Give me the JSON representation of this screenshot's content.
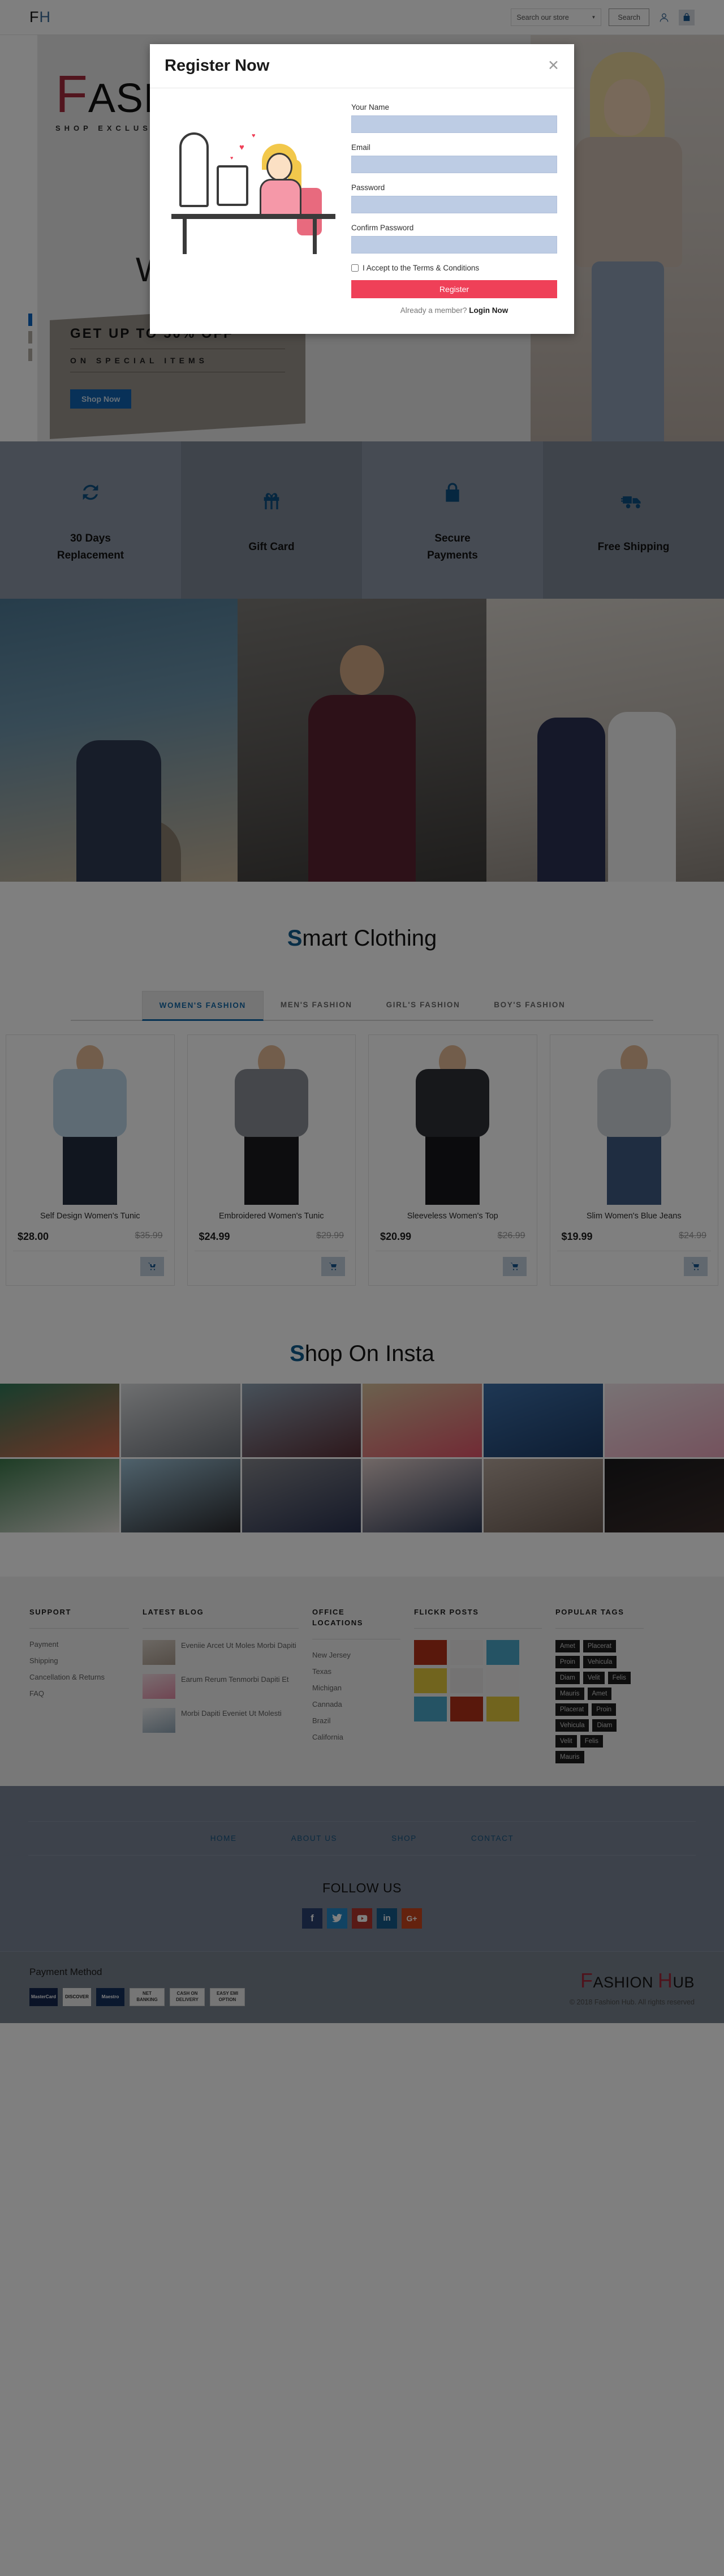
{
  "header": {
    "logo_first": "F",
    "logo_second": "H",
    "search_placeholder": "Search our store",
    "search_caret": "▼",
    "search_button": "Search",
    "account_icon": "user-icon",
    "cart_icon": "shopping-bag-icon"
  },
  "hero": {
    "brand_cap": "F",
    "brand_rest": "ASHION HUB",
    "tagline": "SHOP EXCLUSIVE",
    "welcome": "Welcome",
    "offer_line1": "GET UP TO 50% OFF",
    "offer_line2": "ON     SPECIAL     ITEMS",
    "shop_now": "Shop Now"
  },
  "features": [
    {
      "icon": "refresh-icon",
      "label": "30 Days\nReplacement"
    },
    {
      "icon": "gift-icon",
      "label": "Gift Card"
    },
    {
      "icon": "lock-icon",
      "label": "Secure\nPayments"
    },
    {
      "icon": "truck-icon",
      "label": "Free Shipping"
    }
  ],
  "smart_clothing": {
    "title_cap": "S",
    "title_rest": "mart Clothing",
    "tabs": [
      {
        "label": "WOMEN'S FASHION",
        "active": true
      },
      {
        "label": "MEN'S FASHION",
        "active": false
      },
      {
        "label": "GIRL'S FASHION",
        "active": false
      },
      {
        "label": "BOY'S FASHION",
        "active": false
      }
    ],
    "products": [
      {
        "name": "Self Design Women's Tunic",
        "price": "$28.00",
        "old_price": "$35.99",
        "cart_icon": "add-to-cart-icon",
        "shirt_color": "#bcd6e8"
      },
      {
        "name": "Embroidered Women's Tunic",
        "price": "$24.99",
        "old_price": "$29.99",
        "cart_icon": "add-to-cart-icon",
        "shirt_color": "#8b8f96"
      },
      {
        "name": "Sleeveless Women's Top",
        "price": "$20.99",
        "old_price": "$26.99",
        "cart_icon": "add-to-cart-icon",
        "shirt_color": "#2f3136"
      },
      {
        "name": "Slim Women's Blue Jeans",
        "price": "$19.99",
        "old_price": "$24.99",
        "cart_icon": "add-to-cart-icon",
        "shirt_color": "#cfd5db"
      }
    ]
  },
  "shop_insta": {
    "title_cap": "S",
    "title_rest": "hop On Insta",
    "tiles": [
      "#2f7a5a",
      "#b9bcc0",
      "#6a7d8c",
      "#c3a378",
      "#2f5fa0",
      "#ead7de",
      "#3d7a4c",
      "#8fb3c9",
      "#6f7680",
      "#d8c5c4",
      "#9a8f88",
      "#1a1a1c"
    ]
  },
  "footer": {
    "support": {
      "title": "SUPPORT",
      "links": [
        "Payment",
        "Shipping",
        "Cancellation & Returns",
        "FAQ"
      ]
    },
    "blog": {
      "title": "LATEST BLOG",
      "posts": [
        {
          "text": "Eveniie Arcet Ut Moles Morbi Dapiti",
          "thumb": "#cbc3bb"
        },
        {
          "text": "Earum Rerum Tenmorbi Dapiti Et",
          "thumb": "#e8c8d2"
        },
        {
          "text": "Morbi Dapiti Eveniet Ut Molesti",
          "thumb": "#dfe2e6"
        }
      ]
    },
    "office": {
      "title": "OFFICE LOCATIONS",
      "locations": [
        "New Jersey",
        "Texas",
        "Michigan",
        "Cannada",
        "Brazil",
        "California"
      ]
    },
    "flickr": {
      "title": "FLICKR POSTS",
      "cells": [
        "#b33018",
        "#eceaea",
        "#4aa7c8",
        "#e3c93c",
        "#e9e7e6",
        "#f0efef",
        "#4aa7c8",
        "#b33018",
        "#e3c93c"
      ]
    },
    "tags": {
      "title": "POPULAR TAGS",
      "items": [
        "Amet",
        "Placerat",
        "Proin",
        "Vehicula",
        "Diam",
        "Velit",
        "Felis",
        "Mauris",
        "Amet",
        "Placerat",
        "Proin",
        "Vehicula",
        "Diam",
        "Velit",
        "Felis",
        "Mauris"
      ]
    },
    "nav": [
      "HOME",
      "ABOUT US",
      "SHOP",
      "CONTACT"
    ],
    "follow_title": "FOLLOW US",
    "socials": [
      {
        "name": "facebook-icon",
        "glyph": "f",
        "color": "#2b4170"
      },
      {
        "name": "twitter-icon",
        "glyph": "t",
        "color": "#2287c6"
      },
      {
        "name": "youtube-icon",
        "glyph": "▶",
        "color": "#b0352c"
      },
      {
        "name": "linkedin-icon",
        "glyph": "in",
        "color": "#155a8a"
      },
      {
        "name": "google-plus-icon",
        "glyph": "G+",
        "color": "#c8441d"
      }
    ],
    "payment_title": "Payment Method",
    "payment_methods": [
      {
        "label": "MasterCard",
        "bg": "#15264f",
        "fg": "#ffffff"
      },
      {
        "label": "DISCOVER",
        "bg": "#ededed",
        "fg": "#1a1a1a"
      },
      {
        "label": "Maestro",
        "bg": "#14305c",
        "fg": "#ffffff"
      },
      {
        "label": "NET BANKING",
        "bg": "#ededed",
        "fg": "#333333"
      },
      {
        "label": "CASH ON DELIVERY",
        "bg": "#ededed",
        "fg": "#333333"
      },
      {
        "label": "EASY EMI OPTION",
        "bg": "#ededed",
        "fg": "#333333"
      }
    ],
    "brand_f": "F",
    "brand_ashion": "ASHION ",
    "brand_h": "H",
    "brand_ub": "UB",
    "copyright": "© 2018 Fashion Hub. All rights reserved"
  },
  "modal": {
    "title": "Register Now",
    "close_label": "✕",
    "fields": [
      {
        "label": "Your Name",
        "value": "",
        "placeholder": ""
      },
      {
        "label": "Email",
        "value": "",
        "placeholder": ""
      },
      {
        "label": "Password",
        "value": "",
        "placeholder": ""
      },
      {
        "label": "Confirm Password",
        "value": "",
        "placeholder": ""
      }
    ],
    "terms_label": "I Accept to the Terms & Conditions",
    "terms_checked": false,
    "submit_label": "Register",
    "footer_prefix": "Already a member? ",
    "footer_link": "Login Now"
  }
}
